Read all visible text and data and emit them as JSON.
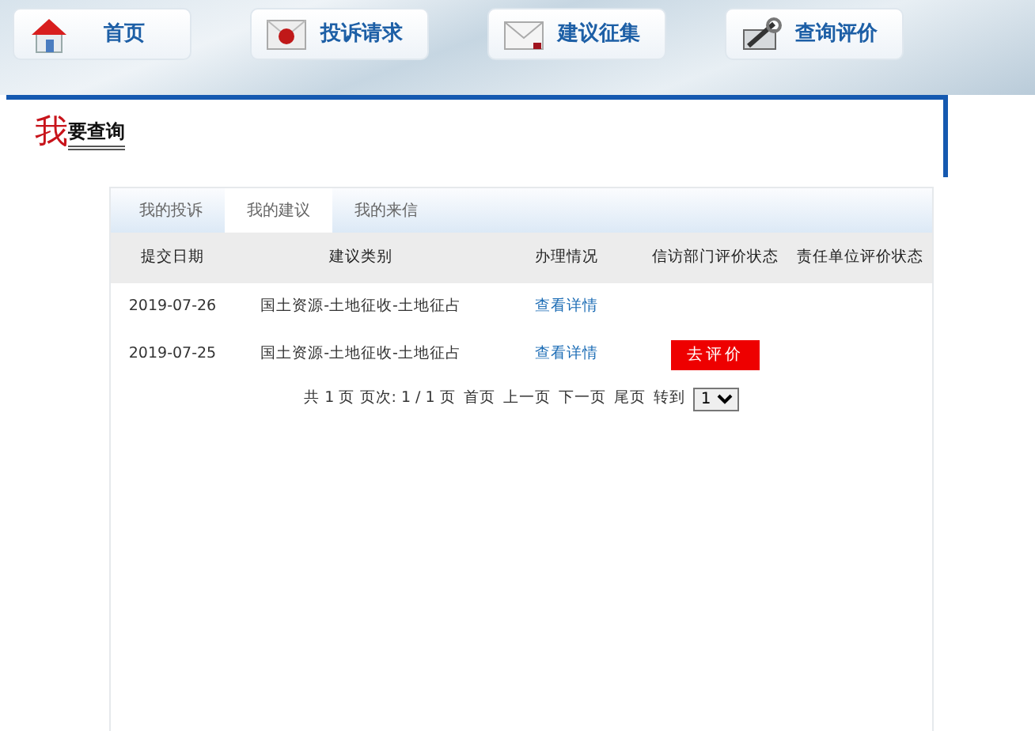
{
  "nav": [
    {
      "label": "首页"
    },
    {
      "label": "投诉请求"
    },
    {
      "label": "建议征集"
    },
    {
      "label": "查询评价"
    }
  ],
  "heading": {
    "accent": "我",
    "rest": "要查询"
  },
  "tabs": [
    {
      "label": "我的投诉",
      "selected": false
    },
    {
      "label": "我的建议",
      "selected": true
    },
    {
      "label": "我的来信",
      "selected": false
    }
  ],
  "table": {
    "columns": [
      "提交日期",
      "建议类别",
      "办理情况",
      "信访部门评价状态",
      "责任单位评价状态"
    ],
    "rows": [
      {
        "date": "2019-07-26",
        "category": "国土资源-土地征收-土地征占",
        "detail_link": "查看详情"
      },
      {
        "date": "2019-07-25",
        "category": "国土资源-土地征收-土地征占",
        "detail_link": "查看详情",
        "evaluate_button": "去评价"
      }
    ]
  },
  "pagination": {
    "info": "共 1 页 页次: 1 / 1 页",
    "links": [
      "首页",
      "上一页",
      "下一页",
      "尾页"
    ],
    "goto_label": "转到",
    "page_select": "1"
  }
}
